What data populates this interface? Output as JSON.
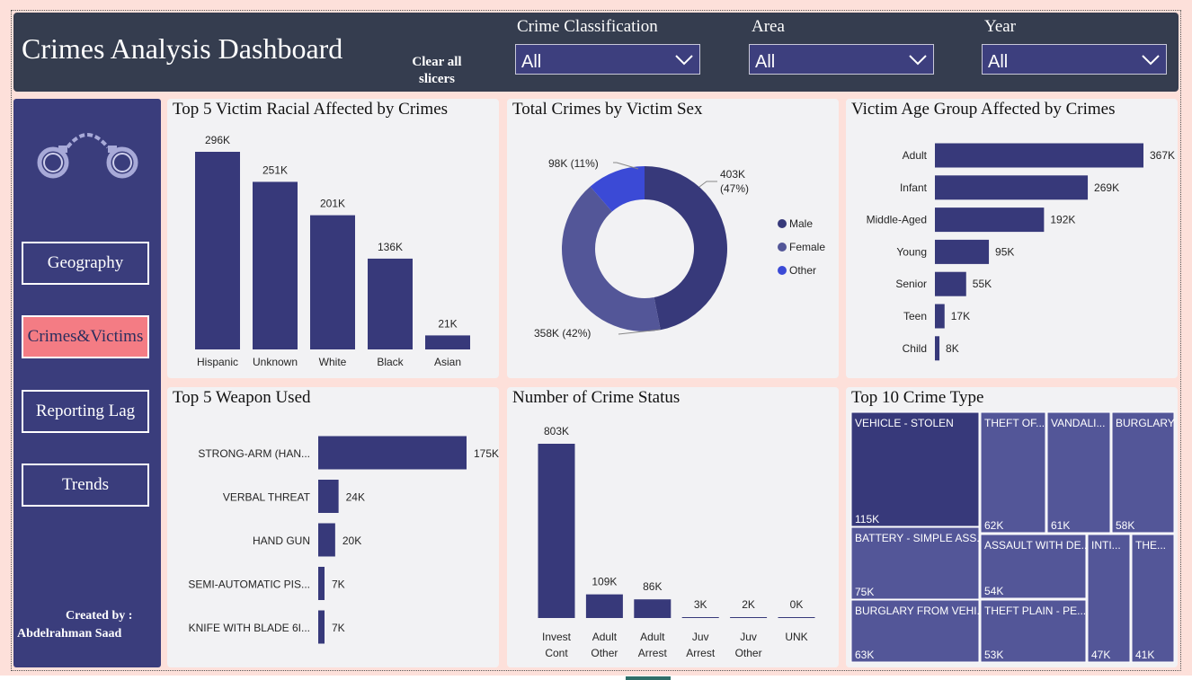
{
  "header": {
    "title": "Crimes Analysis Dashboard",
    "clear_label": "Clear all slicers",
    "slicers": [
      {
        "label": "Crime Classification",
        "value": "All"
      },
      {
        "label": "Area",
        "value": "All"
      },
      {
        "label": "Year",
        "value": "All"
      }
    ]
  },
  "sidebar": {
    "logo_icon": "handcuffs-icon",
    "nav": [
      {
        "label": "Geography",
        "active": false
      },
      {
        "label": "Crimes&Victims",
        "active": true
      },
      {
        "label": "Reporting Lag",
        "active": false
      },
      {
        "label": "Trends",
        "active": false
      }
    ],
    "credit_label": "Created by :",
    "credit_name": "Abdelrahman Saad"
  },
  "colors": {
    "primary": "#37397a",
    "secondary": "#535698",
    "accent": "#3b4ad6",
    "header": "#353d4f",
    "active_nav": "#f47c84",
    "background": "#fde0da"
  },
  "chart_data": [
    {
      "id": "racial",
      "type": "bar",
      "title": "Top 5 Victim Racial Affected by Crimes",
      "categories": [
        "Hispanic",
        "Unknown",
        "White",
        "Black",
        "Asian"
      ],
      "values": [
        296000,
        251000,
        201000,
        136000,
        21000
      ],
      "labels": [
        "296K",
        "251K",
        "201K",
        "136K",
        "21K"
      ]
    },
    {
      "id": "sex",
      "type": "pie",
      "title": "Total Crimes by Victim Sex",
      "categories": [
        "Male",
        "Female",
        "Other"
      ],
      "values": [
        403000,
        358000,
        98000
      ],
      "labels": [
        "403K (47%)",
        "358K (42%)",
        "98K (11%)"
      ],
      "legend": [
        "Male",
        "Female",
        "Other"
      ]
    },
    {
      "id": "age",
      "type": "bar",
      "orientation": "horizontal",
      "title": "Victim Age Group Affected by Crimes",
      "categories": [
        "Adult",
        "Infant",
        "Middle-Aged",
        "Young",
        "Senior",
        "Teen",
        "Child"
      ],
      "values": [
        367000,
        269000,
        192000,
        95000,
        55000,
        17000,
        8000
      ],
      "labels": [
        "367K",
        "269K",
        "192K",
        "95K",
        "55K",
        "17K",
        "8K"
      ]
    },
    {
      "id": "weapon",
      "type": "bar",
      "orientation": "horizontal",
      "title": "Top 5 Weapon Used",
      "categories": [
        "STRONG-ARM (HAN...",
        "VERBAL THREAT",
        "HAND GUN",
        "SEMI-AUTOMATIC PIS...",
        "KNIFE WITH BLADE 6I..."
      ],
      "values": [
        175000,
        24000,
        20000,
        7000,
        7000
      ],
      "labels": [
        "175K",
        "24K",
        "20K",
        "7K",
        "7K"
      ]
    },
    {
      "id": "status",
      "type": "bar",
      "title": "Number of Crime Status",
      "categories": [
        [
          "Invest",
          "Cont"
        ],
        [
          "Adult",
          "Other"
        ],
        [
          "Adult",
          "Arrest"
        ],
        [
          "Juv",
          "Arrest"
        ],
        [
          "Juv",
          "Other"
        ],
        [
          "UNK"
        ]
      ],
      "values": [
        803000,
        109000,
        86000,
        3000,
        2000,
        0
      ],
      "labels": [
        "803K",
        "109K",
        "86K",
        "3K",
        "2K",
        "0K"
      ]
    },
    {
      "id": "crimetype",
      "type": "treemap",
      "title": "Top 10 Crime Type",
      "categories": [
        "VEHICLE - STOLEN",
        "THEFT OF...",
        "VANDALI...",
        "BURGLARY",
        "BATTERY - SIMPLE ASS...",
        "ASSAULT WITH DE...",
        "INTI...",
        "THE...",
        "BURGLARY FROM VEHI...",
        "THEFT PLAIN - PE..."
      ],
      "values": [
        115000,
        62000,
        61000,
        58000,
        75000,
        54000,
        47000,
        41000,
        63000,
        53000
      ],
      "labels": [
        "115K",
        "62K",
        "61K",
        "58K",
        "75K",
        "54K",
        "47K",
        "41K",
        "63K",
        "53K"
      ]
    }
  ]
}
